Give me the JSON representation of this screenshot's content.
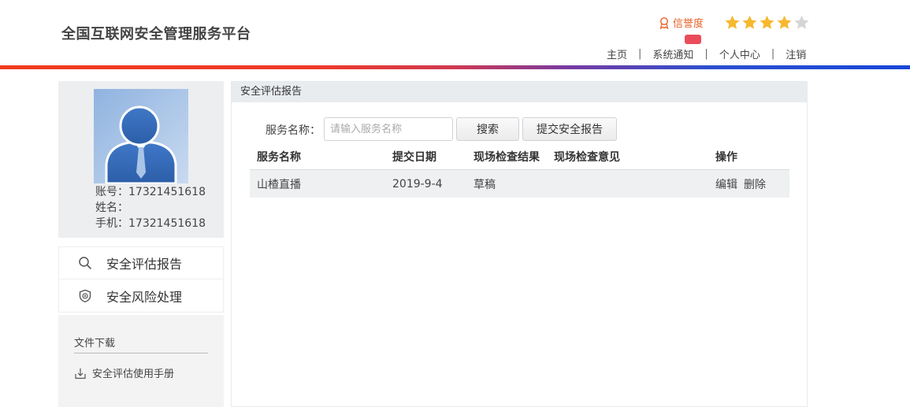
{
  "header": {
    "title": "全国互联网安全管理服务平台",
    "credit_label": "信誉度",
    "rating": {
      "filled": 4,
      "total": 5
    },
    "colors": {
      "accent": "#e8622a",
      "star_filled": "#f7b830",
      "star_empty": "#d5d5d5",
      "badge": "#ea4d5a"
    },
    "nav": [
      {
        "label": "主页"
      },
      {
        "label": "系统通知"
      },
      {
        "label": "个人中心"
      },
      {
        "label": "注销"
      }
    ]
  },
  "profile": {
    "account": "账号：17321451618",
    "name": "姓名：",
    "phone": "手机：17321451618"
  },
  "sidebar": {
    "items": [
      {
        "label": "安全评估报告",
        "icon": "search-icon"
      },
      {
        "label": "安全风险处理",
        "icon": "shield-icon"
      }
    ],
    "downloads": {
      "title": "文件下载",
      "items": [
        {
          "label": "安全评估使用手册",
          "icon": "download-icon"
        }
      ]
    }
  },
  "main": {
    "panel_title": "安全评估报告",
    "search": {
      "label": "服务名称：",
      "placeholder": "请输入服务名称",
      "value": "",
      "search_button": "搜索",
      "submit_button": "提交安全报告"
    },
    "table": {
      "columns": [
        "服务名称",
        "提交日期",
        "现场检查结果",
        "现场检查意见",
        "操作"
      ],
      "rows": [
        {
          "name": "山楂直播",
          "date": "2019-9-4",
          "result": "草稿",
          "opinion": "",
          "actions": [
            "编辑",
            "删除"
          ]
        }
      ]
    }
  }
}
